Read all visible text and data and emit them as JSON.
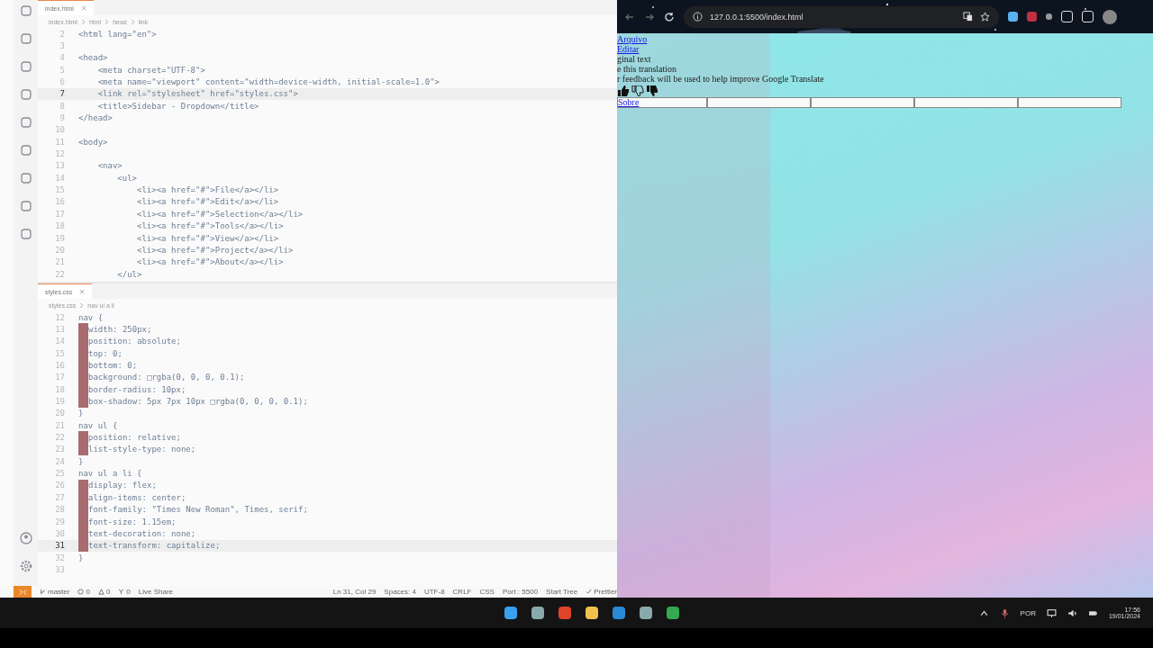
{
  "editors": [
    {
      "tab": "index.html",
      "breadcrumb": [
        "index.html",
        "html",
        "head",
        "link"
      ],
      "lines": [
        {
          "num": "2",
          "text": "<html lang=\"en\">",
          "current": false,
          "marked": false
        },
        {
          "num": "3",
          "current": false,
          "marked": false
        },
        {
          "num": "4",
          "text": "<head>",
          "current": false,
          "marked": false
        },
        {
          "num": "5",
          "text": "    <meta charset=\"UTF-8\">",
          "current": false,
          "marked": false
        },
        {
          "num": "6",
          "text": "    <meta name=\"viewport\" content=\"width=device-width, initial-scale=1.0\">",
          "current": false,
          "marked": false
        },
        {
          "num": "7",
          "text": "    <link rel=\"stylesheet\" href=\"styles.css\">",
          "current": true,
          "marked": false
        },
        {
          "num": "8",
          "text": "    <title>Sidebar - Dropdown</title>",
          "current": false,
          "marked": false
        },
        {
          "num": "9",
          "text": "</head>",
          "current": false,
          "marked": false
        },
        {
          "num": "10",
          "current": false,
          "marked": false
        },
        {
          "num": "11",
          "text": "<body>",
          "current": false,
          "marked": false
        },
        {
          "num": "12",
          "current": false,
          "marked": false
        },
        {
          "num": "13",
          "text": "    <nav>",
          "current": false,
          "marked": false
        },
        {
          "num": "14",
          "text": "        <ul>",
          "current": false,
          "marked": false
        },
        {
          "num": "15",
          "text": "            <li><a href=\"#\">File</a></li>",
          "current": false,
          "marked": false
        },
        {
          "num": "16",
          "text": "            <li><a href=\"#\">Edit</a></li>",
          "current": false,
          "marked": false
        },
        {
          "num": "17",
          "text": "            <li><a href=\"#\">Selection</a></li>",
          "current": false,
          "marked": false
        },
        {
          "num": "18",
          "text": "            <li><a href=\"#\">Tools</a></li>",
          "current": false,
          "marked": false
        },
        {
          "num": "19",
          "text": "            <li><a href=\"#\">View</a></li>",
          "current": false,
          "marked": false
        },
        {
          "num": "20",
          "text": "            <li><a href=\"#\">Project</a></li>",
          "current": false,
          "marked": false
        },
        {
          "num": "21",
          "text": "            <li><a href=\"#\">About</a></li>",
          "current": false,
          "marked": false
        },
        {
          "num": "22",
          "text": "        </ul>",
          "current": false,
          "marked": false
        }
      ]
    },
    {
      "tab": "styles.css",
      "breadcrumb": [
        "styles.css",
        "nav ul a li"
      ],
      "lines": [
        {
          "num": "12",
          "text": "nav {",
          "current": false,
          "marked": false
        },
        {
          "num": "13",
          "text": "width: 250px;",
          "current": false,
          "marked": true
        },
        {
          "num": "14",
          "text": "position: absolute;",
          "current": false,
          "marked": true
        },
        {
          "num": "15",
          "text": "top: 0;",
          "current": false,
          "marked": true
        },
        {
          "num": "16",
          "text": "bottom: 0;",
          "current": false,
          "marked": true
        },
        {
          "num": "17",
          "text": "background: □rgba(0, 0, 0, 0.1);",
          "current": false,
          "marked": true
        },
        {
          "num": "18",
          "text": "border-radius: 10px;",
          "current": false,
          "marked": true
        },
        {
          "num": "19",
          "text": "box-shadow: 5px 7px 10px □rgba(0, 0, 0, 0.1);",
          "current": false,
          "marked": true
        },
        {
          "num": "20",
          "text": "}",
          "current": false,
          "marked": false
        },
        {
          "num": "21",
          "text": "nav ul {",
          "current": false,
          "marked": false
        },
        {
          "num": "22",
          "text": "position: relative;",
          "current": false,
          "marked": true
        },
        {
          "num": "23",
          "text": "list-style-type: none;",
          "current": false,
          "marked": true
        },
        {
          "num": "24",
          "text": "}",
          "current": false,
          "marked": false
        },
        {
          "num": "25",
          "text": "nav ul a li {",
          "current": false,
          "marked": false
        },
        {
          "num": "26",
          "text": "display: flex;",
          "current": false,
          "marked": true
        },
        {
          "num": "27",
          "text": "align-items: center;",
          "current": false,
          "marked": true
        },
        {
          "num": "28",
          "text": "font-family: \"Times New Roman\", Times, serif;",
          "current": false,
          "marked": true
        },
        {
          "num": "29",
          "text": "font-size: 1.15em;",
          "current": false,
          "marked": true
        },
        {
          "num": "30",
          "text": "text-decoration: none;",
          "current": false,
          "marked": true
        },
        {
          "num": "31",
          "text": "text-transform: capitalize;",
          "current": true,
          "marked": true
        },
        {
          "num": "32",
          "text": "}",
          "current": false,
          "marked": false
        },
        {
          "num": "33",
          "current": false,
          "marked": false
        }
      ]
    }
  ],
  "status_bar": {
    "branch": "master",
    "errors": "0",
    "warnings": "0",
    "ports": "0",
    "live_share": "Live Share",
    "right": [
      "Ln 31, Col 29",
      "Spaces: 4",
      "UTF-8",
      "CRLF",
      "CSS",
      "Port : 5500"
    ],
    "start_tree": "Start Tree",
    "prettier": "Prettier"
  },
  "browser": {
    "url": "127.0.0.1:5500/index.html",
    "nav_links": [
      "Arquivo",
      "Editar"
    ],
    "translate_popup": [
      "ginal text",
      "e this translation",
      "r feedback will be used to help improve Google Translate"
    ],
    "last_link": "Sobre"
  },
  "taskbar": {
    "language": "POR",
    "time": "17:56",
    "date": "19/01/2024"
  }
}
